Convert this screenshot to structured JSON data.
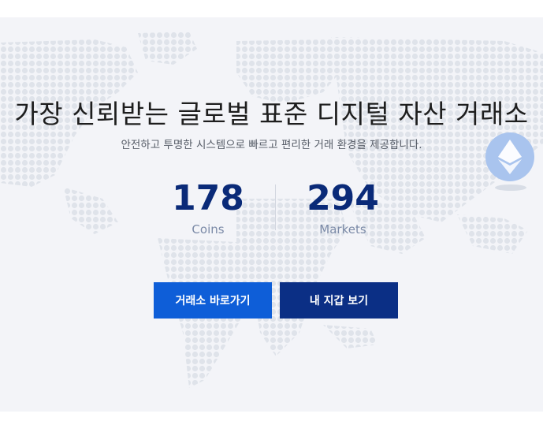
{
  "hero": {
    "headline": "가장 신뢰받는 글로벌 표준 디지털 자산 거래소",
    "subheadline": "안전하고 투명한 시스템으로 빠르고 편리한 거래 환경을 제공합니다."
  },
  "stats": [
    {
      "value": "178",
      "label": "Coins"
    },
    {
      "value": "294",
      "label": "Markets"
    }
  ],
  "buttons": {
    "exchange_label": "거래소 바로가기",
    "wallet_label": "내 지갑 보기"
  },
  "icons": {
    "eth": "ethereum-icon",
    "map": "world-map-icon"
  },
  "colors": {
    "stat_value": "#0a2a78",
    "primary_button": "#0e5ed8",
    "secondary_button": "#0b2f85",
    "background": "#f3f4f8"
  }
}
